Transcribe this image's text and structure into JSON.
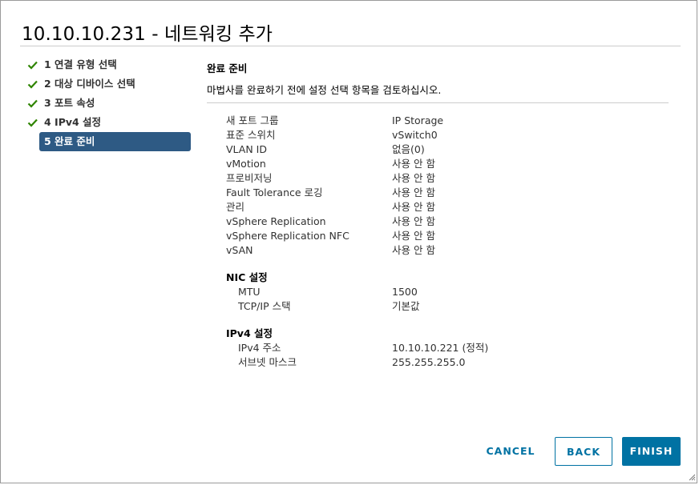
{
  "dialog": {
    "title": "10.10.10.231 - 네트워킹 추가"
  },
  "steps": [
    {
      "label": "1 연결 유형 선택",
      "done": true
    },
    {
      "label": "2 대상 디바이스 선택",
      "done": true
    },
    {
      "label": "3 포트 속성",
      "done": true
    },
    {
      "label": "4 IPv4 설정",
      "done": true
    },
    {
      "label": "5 완료 준비",
      "done": false,
      "active": true
    }
  ],
  "content": {
    "title": "완료 준비",
    "description": "마법사를 완료하기 전에 설정 선택 항목을 검토하십시오."
  },
  "summary": {
    "port_group": {
      "key": "새 포트 그룹",
      "value": "IP Storage"
    },
    "switch": {
      "key": "표준 스위치",
      "value": "vSwitch0"
    },
    "vlan": {
      "key": "VLAN ID",
      "value": "없음(0)"
    },
    "vmotion": {
      "key": "vMotion",
      "value": "사용 안 함"
    },
    "provisioning": {
      "key": "프로비저닝",
      "value": "사용 안 함"
    },
    "fault_tolerance": {
      "key": "Fault Tolerance 로깅",
      "value": "사용 안 함"
    },
    "management": {
      "key": "관리",
      "value": "사용 안 함"
    },
    "replication": {
      "key": "vSphere Replication",
      "value": "사용 안 함"
    },
    "replication_nfc": {
      "key": "vSphere Replication NFC",
      "value": "사용 안 함"
    },
    "vsan": {
      "key": "vSAN",
      "value": "사용 안 함"
    }
  },
  "nic": {
    "title": "NIC 설정",
    "mtu": {
      "key": "MTU",
      "value": "1500"
    },
    "stack": {
      "key": "TCP/IP 스택",
      "value": "기본값"
    }
  },
  "ipv4": {
    "title": "IPv4 설정",
    "address": {
      "key": "IPv4 주소",
      "value": "10.10.10.221 (정적)"
    },
    "subnet": {
      "key": "서브넷 마스크",
      "value": "255.255.255.0"
    }
  },
  "buttons": {
    "cancel": "CANCEL",
    "back": "BACK",
    "finish": "FINISH"
  },
  "colors": {
    "accent": "#0072a3",
    "active_step": "#2e5a84",
    "check": "#2f8400"
  },
  "icons": {
    "step_done": "check-icon",
    "grip": "resize-grip-icon"
  }
}
